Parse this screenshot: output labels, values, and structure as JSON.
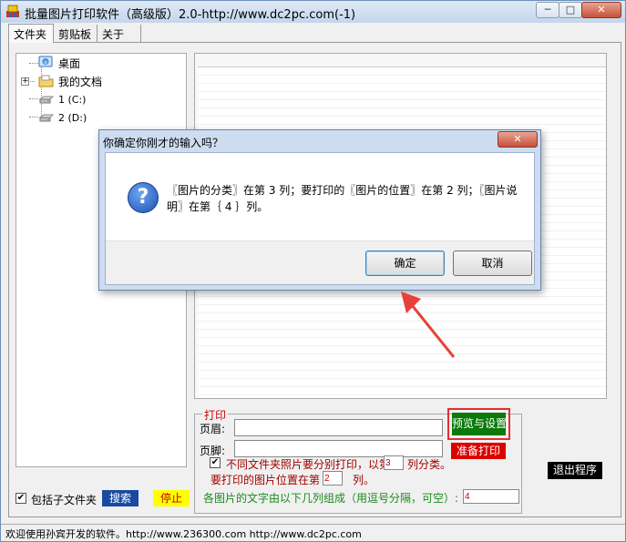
{
  "window": {
    "title": "批量图片打印软件（高级版）2.0-http://www.dc2pc.com(-1)",
    "min_glyph": "─",
    "max_glyph": "□",
    "close_glyph": "✕"
  },
  "tabs": [
    {
      "label": "文件夹",
      "active": true
    },
    {
      "label": "剪贴板",
      "active": false
    },
    {
      "label": "关于",
      "active": false
    }
  ],
  "tree": {
    "items": [
      {
        "label": "桌面",
        "icon": "desktop-icon"
      },
      {
        "label": "我的文档",
        "icon": "folder-icon"
      },
      {
        "label": "1 (C:)",
        "icon": "drive-icon"
      },
      {
        "label": "2 (D:)",
        "icon": "drive-icon"
      }
    ],
    "expand_glyph": "+"
  },
  "print": {
    "legend": "打印",
    "header_label": "页眉:",
    "footer_label": "页脚:",
    "header_value": "",
    "footer_value": "",
    "separate_label_pre": "不同文件夹照片要分别打印，以第",
    "separate_label_post": "列分类。",
    "separate_checked": true,
    "separate_col": "3",
    "position_label_pre": "要打印的图片位置在第",
    "position_label_post": "列。",
    "position_col": "2",
    "caption_label": "各图片的文字由以下几列组成（用逗号分隔，可空）:",
    "caption_cols": "4"
  },
  "buttons": {
    "preview": "预览与设置",
    "prepare": "准备打印",
    "exit": "退出程序",
    "search": "搜索",
    "stop": "停止"
  },
  "options": {
    "include_subdirs_label": "包括子文件夹",
    "include_subdirs_checked": true,
    "check_glyph": "✔"
  },
  "status": {
    "text": "欢迎使用孙宾开发的软件。http://www.236300.com http://www.dc2pc.com"
  },
  "dialog": {
    "title": "你确定你刚才的输入吗？",
    "message": "〖图片的分类〗在第 3 列；要打印的〖图片的位置〗在第 2 列；〖图片说明〗在第｛ 4 ｝列。",
    "icon_glyph": "?",
    "ok": "确定",
    "cancel": "取消",
    "close_glyph": "✕"
  },
  "colors": {
    "preview_button": "#0a7a0a",
    "preview_highlight": "#e03030",
    "prepare_button": "#dd0000",
    "search_button": "#1a4aa0",
    "stop_button": "#ffff00",
    "arrow": "#e8413a"
  }
}
